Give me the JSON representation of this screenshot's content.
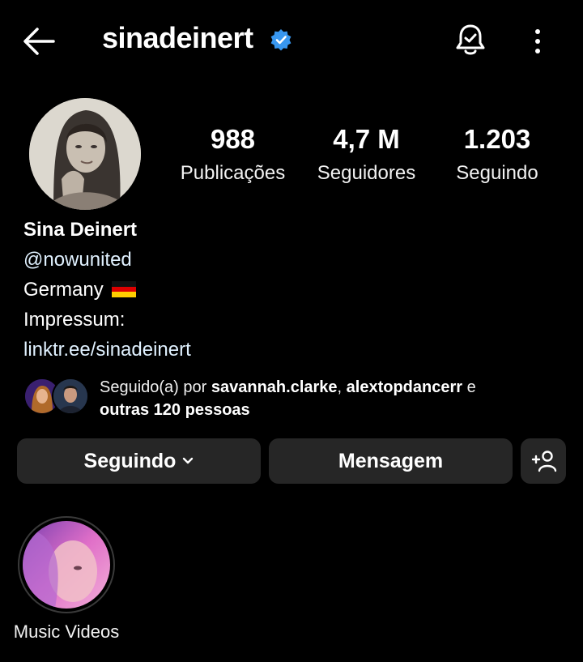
{
  "header": {
    "username": "sinadeinert",
    "icons": {
      "back": "arrow-left-icon",
      "verified": "verified-badge-icon",
      "notifications": "bell-icon",
      "more": "more-vertical-icon"
    }
  },
  "stats": [
    {
      "value": "988",
      "label": "Publicações"
    },
    {
      "value": "4,7 M",
      "label": "Seguidores"
    },
    {
      "value": "1.203",
      "label": "Seguindo"
    }
  ],
  "bio": {
    "name": "Sina Deinert",
    "mention": "@nowunited",
    "location": "Germany",
    "impressum": "Impressum:",
    "link": "linktr.ee/sinadeinert"
  },
  "followed_by": {
    "prefix": "Seguido(a) por ",
    "user1": "savannah.clarke",
    "sep": ", ",
    "user2": "alextopdancerr",
    "conj": " e",
    "others": "outras 120 pessoas"
  },
  "actions": {
    "following_label": "Seguindo",
    "message_label": "Mensagem",
    "add_user_icon": "add-person-icon"
  },
  "highlights": [
    {
      "label": "Music Videos"
    }
  ],
  "colors": {
    "background": "#000000",
    "button": "#262626",
    "verified": "#3897f0",
    "link": "#e0f1ff"
  }
}
